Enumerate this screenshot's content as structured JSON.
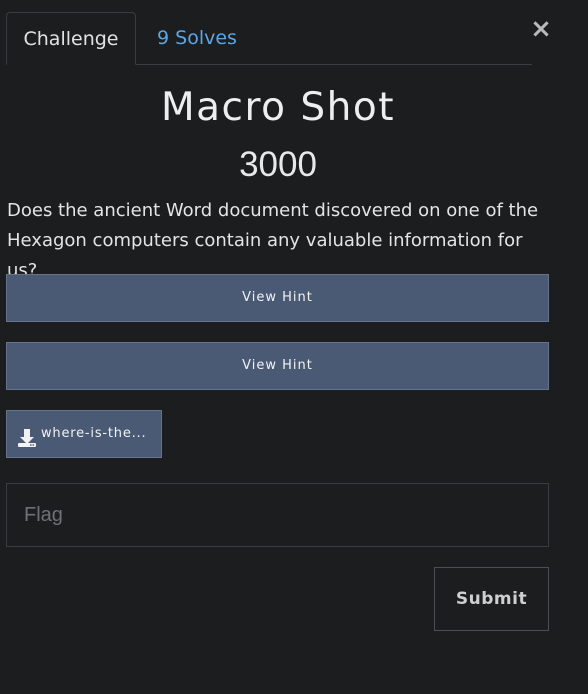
{
  "modal": {
    "close_glyph": "×",
    "tabs": [
      {
        "label": "Challenge",
        "active": true
      },
      {
        "label": "9 Solves",
        "active": false
      }
    ],
    "title": "Macro Shot",
    "points": "3000",
    "description": "Does the ancient Word document discovered on one of the Hexagon computers contain any valuable information for us?",
    "hints": [
      {
        "label": "View Hint"
      },
      {
        "label": "View Hint"
      }
    ],
    "file": {
      "label": "where-is-the...",
      "icon": "download-icon"
    },
    "flag_input": {
      "placeholder": "Flag",
      "value": ""
    },
    "submit_label": "Submit"
  },
  "colors": {
    "background": "#1c1d1f",
    "button": "#4a5a75",
    "link": "#5aa7e8",
    "text": "#e4e4e4"
  }
}
